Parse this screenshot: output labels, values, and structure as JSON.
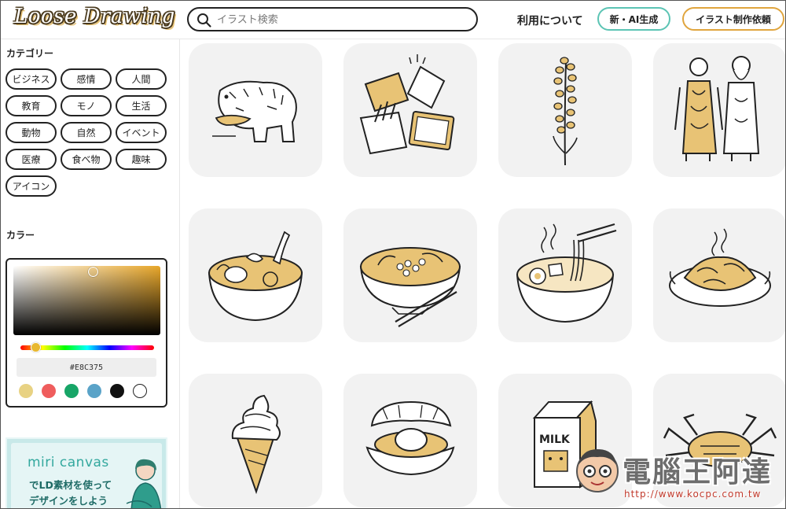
{
  "header": {
    "logo": "Loose Drawing",
    "search_placeholder": "イラスト検索",
    "about_link": "利用について",
    "ai_button": "新・AI生成",
    "request_button": "イラスト制作依頼"
  },
  "sidebar": {
    "category_heading": "カテゴリー",
    "categories": [
      "ビジネス",
      "感情",
      "人間",
      "教育",
      "モノ",
      "生活",
      "動物",
      "自然",
      "イベント",
      "医療",
      "食べ物",
      "趣味",
      "アイコン"
    ],
    "color_heading": "カラー",
    "color_picker": {
      "hex_value": "#E8C375",
      "swatches": [
        "#e8d283",
        "#ef5d5d",
        "#17a567",
        "#5aa3c8",
        "#111111",
        "#ffffff"
      ]
    },
    "banner": {
      "logo": "miri canvas",
      "line1": "でLD素材を使って",
      "line2": "デザインをしよう"
    }
  },
  "illustrations": [
    {
      "icon": "bear-with-salmon-icon"
    },
    {
      "icon": "snack-bags-icon"
    },
    {
      "icon": "lavender-flower-icon"
    },
    {
      "icon": "ainu-couple-icon"
    },
    {
      "icon": "soup-curry-icon"
    },
    {
      "icon": "uni-ikura-bowl-icon"
    },
    {
      "icon": "ramen-bowl-icon"
    },
    {
      "icon": "jingisukan-grill-icon"
    },
    {
      "icon": "soft-serve-icon"
    },
    {
      "icon": "scallop-icon"
    },
    {
      "icon": "milk-carton-icon"
    },
    {
      "icon": "king-crab-icon"
    }
  ],
  "illustration_colors": {
    "accent": "#e8c375",
    "line": "#222222",
    "card": "#f2f2f2"
  },
  "watermark": {
    "title": "電腦王阿達",
    "url": "http://www.kocpc.com.tw"
  }
}
